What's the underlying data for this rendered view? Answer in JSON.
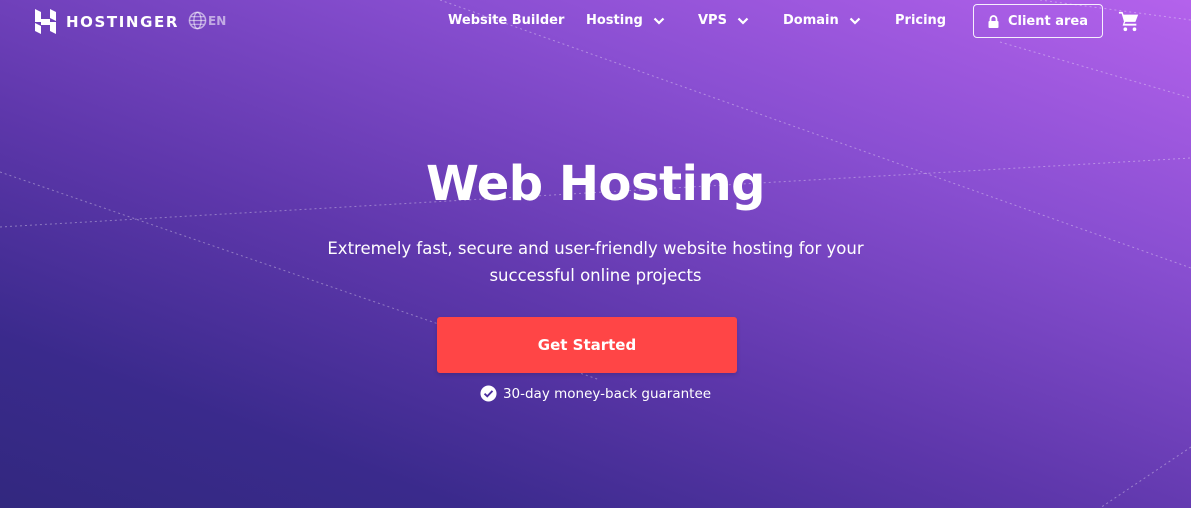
{
  "brand": {
    "name": "HOSTINGER",
    "language": "EN"
  },
  "nav": {
    "items": [
      {
        "label": "Website Builder",
        "has_dropdown": false
      },
      {
        "label": "Hosting",
        "has_dropdown": true
      },
      {
        "label": "VPS",
        "has_dropdown": true
      },
      {
        "label": "Domain",
        "has_dropdown": true
      },
      {
        "label": "Pricing",
        "has_dropdown": false
      }
    ],
    "client_area_label": "Client area",
    "icons": {
      "language": "globe-icon",
      "client_area": "lock-icon",
      "cart": "cart-icon",
      "dropdown": "chevron-down-icon"
    }
  },
  "hero": {
    "title": "Web Hosting",
    "subtitle": "Extremely fast, secure and user-friendly website hosting for your successful online projects",
    "cta_label": "Get Started",
    "guarantee": "30-day money-back guarantee"
  },
  "colors": {
    "cta": "#ff4546",
    "gradient_top_right": "#b462ec",
    "gradient_bottom_left": "#32287f",
    "text": "#ffffff"
  }
}
